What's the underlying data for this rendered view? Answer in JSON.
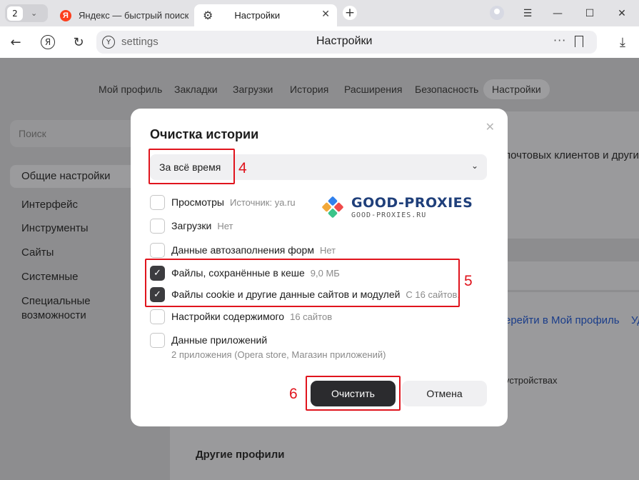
{
  "tabs": {
    "count": "2",
    "inactive_title": "Яндекс — быстрый поиск",
    "active_title": "Настройки"
  },
  "address_bar": {
    "url": "settings",
    "page_title": "Настройки"
  },
  "settings_nav": [
    "Мой профиль",
    "Закладки",
    "Загрузки",
    "История",
    "Расширения",
    "Безопасность",
    "Настройки"
  ],
  "sidebar": {
    "search_placeholder": "Поиск",
    "items": [
      "Общие настройки",
      "Интерфейс",
      "Инструменты",
      "Сайты",
      "Системные",
      "Специальные",
      "возможности"
    ]
  },
  "background_text": {
    "line1": "почтовых клиентов и други",
    "link1": "ерейти в Мой профиль",
    "link2": "Уд",
    "line3": "устройствах",
    "other_profiles": "Другие профили"
  },
  "dialog": {
    "title": "Очистка истории",
    "period": "За всё время",
    "options": [
      {
        "label": "Просмотры",
        "meta": "Источник: ya.ru",
        "checked": false
      },
      {
        "label": "Загрузки",
        "meta": "Нет",
        "checked": false
      },
      {
        "label": "Данные автозаполнения форм",
        "meta": "Нет",
        "checked": false
      },
      {
        "label": "Файлы, сохранённые в кеше",
        "meta": "9,0 МБ",
        "checked": true
      },
      {
        "label": "Файлы cookie и другие данные сайтов и модулей",
        "meta": "С 16 сайтов.",
        "checked": true
      },
      {
        "label": "Настройки содержимого",
        "meta": "16 сайтов",
        "checked": false
      },
      {
        "label": "Данные приложений",
        "meta": "",
        "checked": false
      }
    ],
    "apps_subtext": "2 приложения (Opera store, Магазин приложений)",
    "clear_button": "Очистить",
    "cancel_button": "Отмена"
  },
  "watermark": {
    "title": "GOOD-PROXIES",
    "subtitle": "GOOD-PROXIES.RU"
  },
  "annotations": [
    "4",
    "5",
    "6"
  ],
  "colors": {
    "annotation_red": "#e0141d",
    "primary_button": "#2b2b2e",
    "checkbox_checked": "#3c3c3f",
    "yandex_red": "#fc3f1d"
  }
}
